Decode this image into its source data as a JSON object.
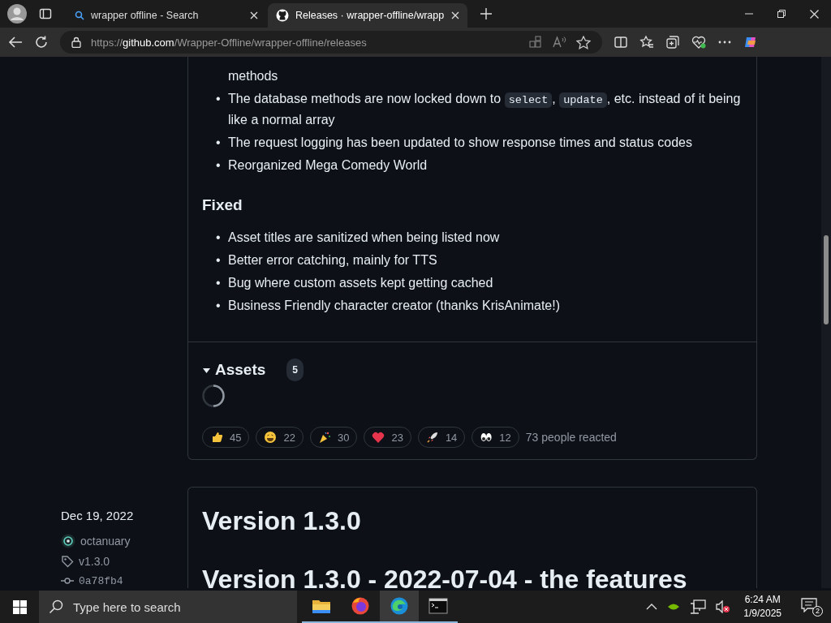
{
  "browser": {
    "tabs": [
      {
        "kind": "search",
        "title": "wrapper offline - Search",
        "selected": false
      },
      {
        "kind": "github",
        "title": "Releases · wrapper-offline/wrapp",
        "selected": true
      }
    ],
    "url": {
      "scheme": "https://",
      "host": "github.com",
      "path": "/Wrapper-Offline/wrapper-offline/releases"
    }
  },
  "release": {
    "bullet": "•",
    "changes": [
      {
        "kind": "continuation",
        "segments": [
          {
            "kind": "text",
            "text": "methods"
          }
        ]
      },
      {
        "kind": "item",
        "segments": [
          {
            "kind": "text",
            "text": "The database methods are now locked down to "
          },
          {
            "kind": "code",
            "text": "select"
          },
          {
            "kind": "text",
            "text": ", "
          },
          {
            "kind": "code",
            "text": "update"
          },
          {
            "kind": "text",
            "text": ", etc. instead of it being like a normal array"
          }
        ]
      },
      {
        "kind": "item",
        "segments": [
          {
            "kind": "text",
            "text": "The request logging has been updated to show response times and status codes"
          }
        ]
      },
      {
        "kind": "item",
        "segments": [
          {
            "kind": "text",
            "text": "Reorganized Mega Comedy World"
          }
        ]
      }
    ],
    "fixed_heading": "Fixed",
    "fixed": [
      "Asset titles are sanitized when being listed now",
      "Better error catching, mainly for TTS",
      "Bug where custom assets kept getting cached",
      "Business Friendly character creator (thanks KrisAnimate!)"
    ],
    "assets": {
      "label": "Assets",
      "count": "5",
      "expanded": true,
      "loading": true
    },
    "reactions": [
      {
        "kind": "thumbs-up",
        "count": "45"
      },
      {
        "kind": "laugh",
        "count": "22"
      },
      {
        "kind": "hooray",
        "count": "30"
      },
      {
        "kind": "heart",
        "count": "23"
      },
      {
        "kind": "rocket",
        "count": "14"
      },
      {
        "kind": "eyes",
        "count": "12"
      }
    ],
    "reacted": "73 people reacted"
  },
  "next_release": {
    "date": "Dec 19, 2022",
    "author": "octanuary",
    "tag": "v1.3.0",
    "commit": "0a78fb4",
    "title": "Version 1.3.0",
    "heading": "Version 1.3.0 - 2022-07-04 - the features"
  },
  "taskbar": {
    "search_placeholder": "Type here to search",
    "apps": [
      {
        "kind": "folder",
        "selected": false
      },
      {
        "kind": "firefox",
        "selected": false
      },
      {
        "kind": "edge",
        "selected": true
      },
      {
        "kind": "terminal",
        "selected": false
      }
    ],
    "time": "6:24 AM",
    "date": "1/9/2025",
    "notifications": "2"
  }
}
